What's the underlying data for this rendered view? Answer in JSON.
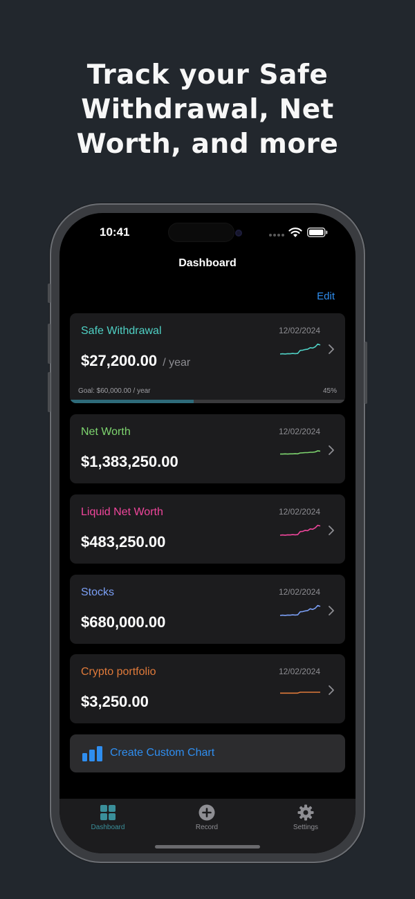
{
  "headline": {
    "line1": "Track your Safe",
    "line2": "Withdrawal, Net",
    "line3": "Worth, and more"
  },
  "status_bar": {
    "time": "10:41"
  },
  "nav": {
    "title": "Dashboard",
    "edit_label": "Edit"
  },
  "cards": [
    {
      "title": "Safe Withdrawal",
      "date": "12/02/2024",
      "value": "$27,200.00",
      "unit": "/ year",
      "color": "#4fd1c5",
      "goal_label": "Goal: $60,000.00 / year",
      "goal_percent_label": "45%",
      "goal_progress": 0.45,
      "trend": [
        0.35,
        0.36,
        0.35,
        0.37,
        0.36,
        0.38,
        0.37,
        0.38,
        0.55,
        0.56,
        0.6,
        0.62,
        0.7,
        0.68,
        0.75,
        0.9,
        0.85
      ]
    },
    {
      "title": "Net Worth",
      "date": "12/02/2024",
      "value": "$1,383,250.00",
      "color": "#7ed56f",
      "trend": [
        0.4,
        0.4,
        0.41,
        0.4,
        0.41,
        0.41,
        0.42,
        0.41,
        0.46,
        0.47,
        0.48,
        0.48,
        0.5,
        0.5,
        0.52,
        0.58,
        0.56
      ]
    },
    {
      "title": "Liquid Net Worth",
      "date": "12/02/2024",
      "value": "$483,250.00",
      "color": "#f0469c",
      "trend": [
        0.35,
        0.36,
        0.35,
        0.37,
        0.36,
        0.38,
        0.37,
        0.38,
        0.55,
        0.56,
        0.62,
        0.6,
        0.7,
        0.68,
        0.76,
        0.9,
        0.86
      ]
    },
    {
      "title": "Stocks",
      "date": "12/02/2024",
      "value": "$680,000.00",
      "color": "#7b9ff5",
      "trend": [
        0.35,
        0.36,
        0.35,
        0.37,
        0.36,
        0.38,
        0.37,
        0.38,
        0.55,
        0.56,
        0.6,
        0.62,
        0.72,
        0.68,
        0.75,
        0.9,
        0.85
      ]
    },
    {
      "title": "Crypto portfolio",
      "date": "12/02/2024",
      "value": "$3,250.00",
      "color": "#e07a3a",
      "trend": [
        0.45,
        0.45,
        0.45,
        0.45,
        0.45,
        0.45,
        0.45,
        0.45,
        0.5,
        0.5,
        0.5,
        0.5,
        0.5,
        0.5,
        0.5,
        0.5,
        0.5
      ]
    }
  ],
  "create_button": {
    "label": "Create Custom Chart"
  },
  "tabs": [
    {
      "label": "Dashboard",
      "icon": "grid-icon",
      "active": true
    },
    {
      "label": "Record",
      "icon": "plus-circle-icon",
      "active": false
    },
    {
      "label": "Settings",
      "icon": "gear-icon",
      "active": false
    }
  ],
  "colors": {
    "background": "#22272d",
    "accent_blue": "#2f8ef0",
    "active_tab": "#3a8f9a",
    "inactive_tab": "#8e8e93"
  }
}
